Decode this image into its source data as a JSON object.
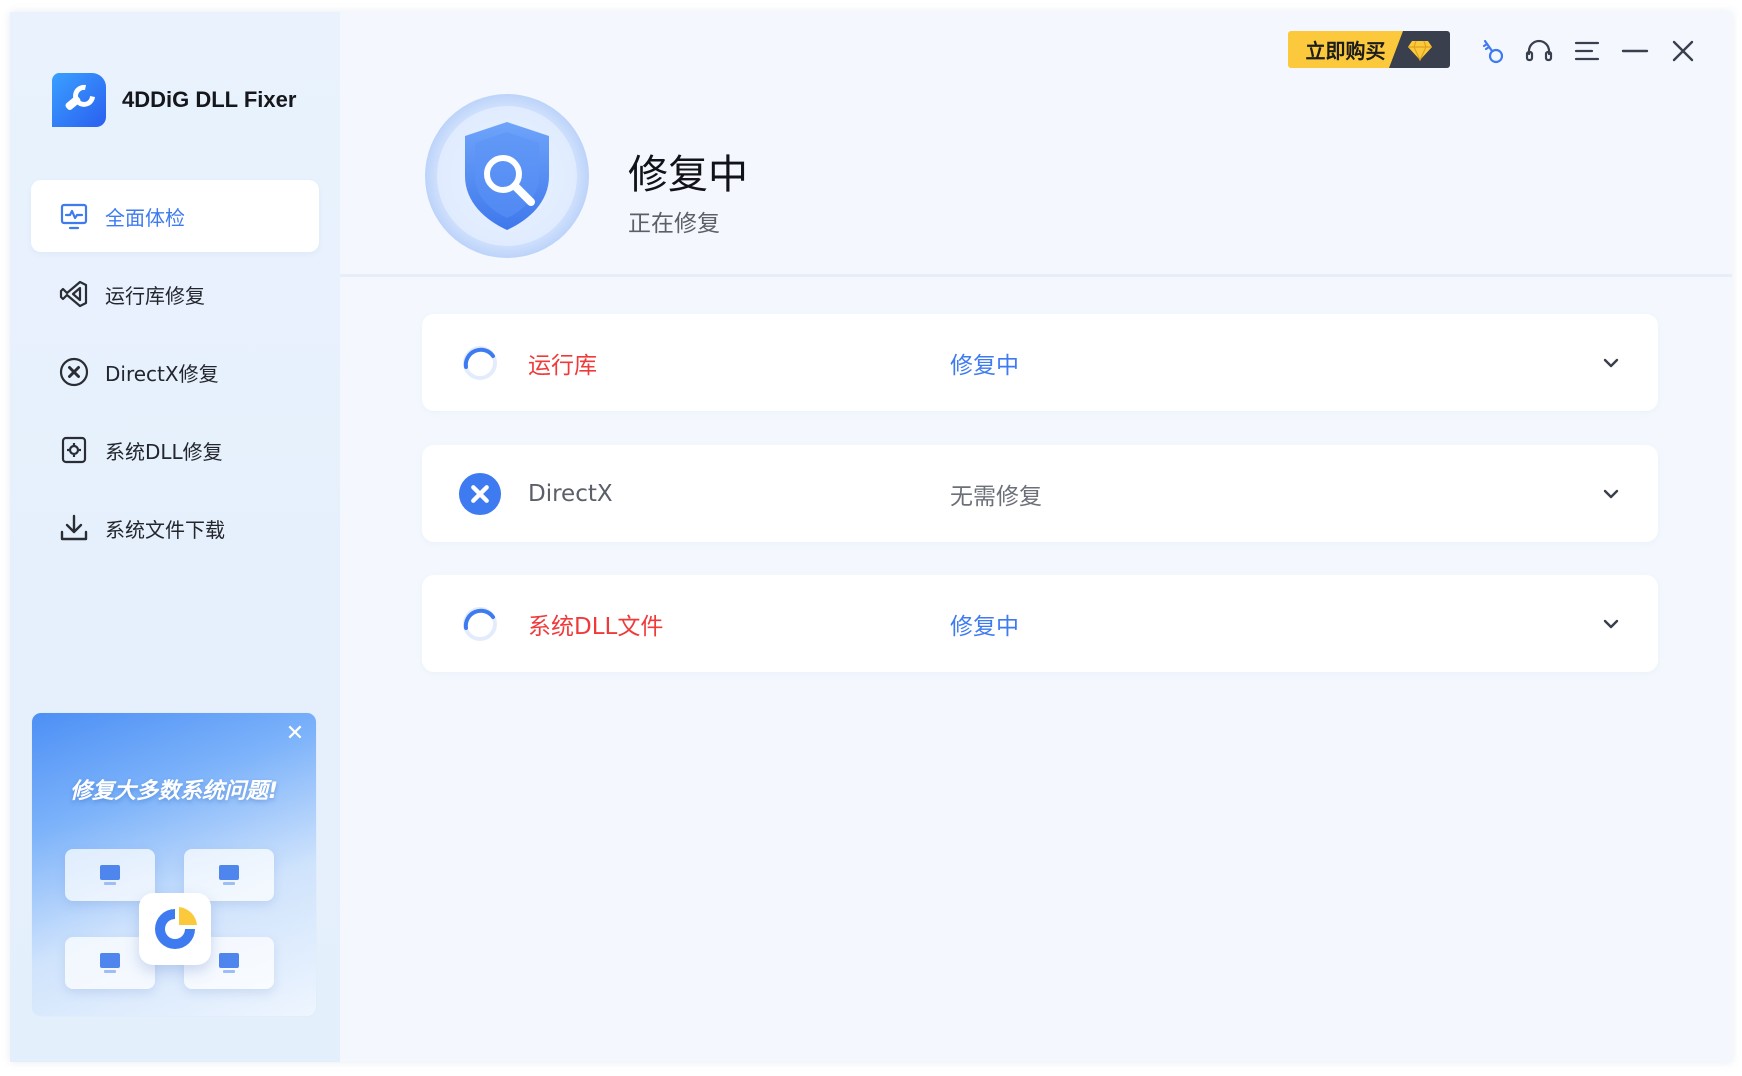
{
  "app": {
    "name": "4DDiG DLL Fixer"
  },
  "topbar": {
    "buy_label": "立即购买",
    "icons": [
      "key-icon",
      "headset-icon",
      "menu-icon",
      "minimize-icon",
      "close-icon"
    ]
  },
  "sidebar": {
    "items": [
      {
        "label": "全面体检",
        "icon": "monitor-pulse-icon",
        "active": true
      },
      {
        "label": "运行库修复",
        "icon": "visual-studio-icon",
        "active": false
      },
      {
        "label": "DirectX修复",
        "icon": "directx-icon",
        "active": false
      },
      {
        "label": "系统DLL修复",
        "icon": "dll-gear-icon",
        "active": false
      },
      {
        "label": "系统文件下载",
        "icon": "download-icon",
        "active": false
      }
    ],
    "promo": {
      "title": "修复大多数系统问题!"
    }
  },
  "header": {
    "title": "修复中",
    "subtitle": "正在修复"
  },
  "rows": [
    {
      "name": "运行库",
      "status": "修复中",
      "state": "in-progress",
      "name_color": "#f03a3a",
      "status_color": "#3e7bf0"
    },
    {
      "name": "DirectX",
      "status": "无需修复",
      "state": "not-needed",
      "name_color": "#5b5f68",
      "status_color": "#6b6f78"
    },
    {
      "name": "系统DLL文件",
      "status": "修复中",
      "state": "in-progress",
      "name_color": "#f03a3a",
      "status_color": "#3e7bf0"
    }
  ],
  "colors": {
    "accent": "#3e7bf0",
    "error": "#f03a3a",
    "buy": "#fcc93c"
  }
}
